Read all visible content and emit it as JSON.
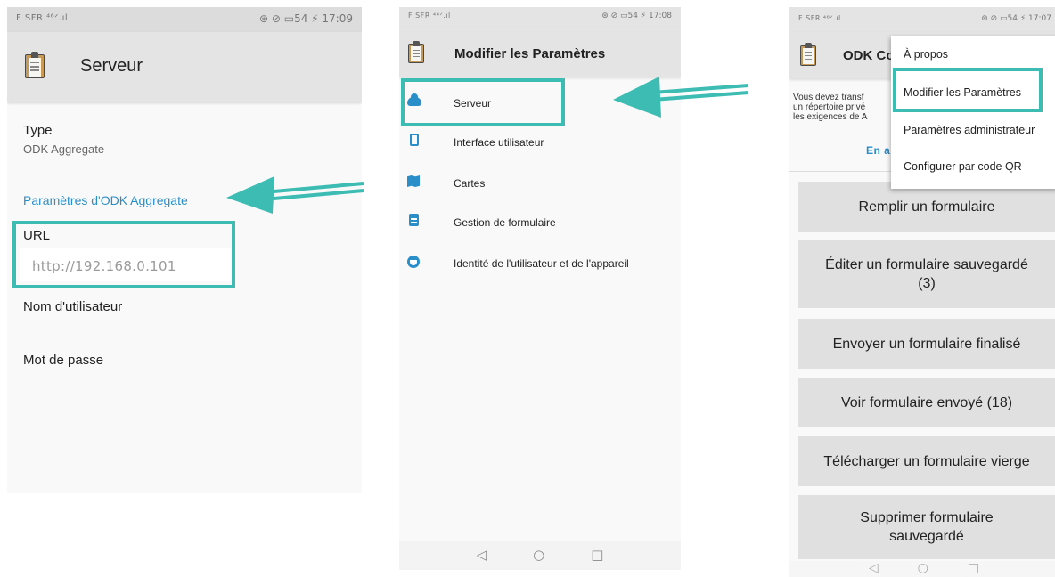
{
  "colors": {
    "accent": "#3cbcb3",
    "link": "#2a8ec9",
    "appbar": "#e4e4e4"
  },
  "screen1": {
    "status_left": "F SFR ⁴⁶ᐟ.ıl",
    "status_right": "⊛ ⊘ ▭54 ⚡ 17:09",
    "title": "Serveur",
    "type_label": "Type",
    "type_value": "ODK Aggregate",
    "category": "Paramètres d'ODK Aggregate",
    "url_label": "URL",
    "url_value": "http://192.168.0.101",
    "username_label": "Nom d'utilisateur",
    "password_label": "Mot de passe"
  },
  "screen2": {
    "status_left": "F SFR ⁴⁶ᐟ.ıl",
    "status_right": "⊛ ⊘ ▭54 ⚡ 17:08",
    "title": "Modifier les Paramètres",
    "items": [
      {
        "label": "Serveur",
        "icon": "cloud-icon"
      },
      {
        "label": "Interface utilisateur",
        "icon": "phone-icon"
      },
      {
        "label": "Cartes",
        "icon": "map-icon"
      },
      {
        "label": "Gestion de formulaire",
        "icon": "clipboard-icon"
      },
      {
        "label": "Identité de l'utilisateur et de l'appareil",
        "icon": "face-icon"
      }
    ],
    "nav": [
      "◁",
      "○",
      "□"
    ]
  },
  "screen3": {
    "status_left": "F SFR ⁴⁶ᐟ.ıl",
    "status_right": "⊛ ⊘ ▭54 ⚡ 17:07",
    "title": "ODK Co",
    "notice": "Vous devez transf\nun répertoire privé\nles exigences de A",
    "notice_link": "En ap",
    "overflow_menu": [
      "À propos",
      "Modifier les Paramètres",
      "Paramètres administrateur",
      "Configurer par code QR"
    ],
    "buttons": [
      "Remplir un formulaire",
      "Éditer un formulaire sauvegardé\n(3)",
      "Envoyer un formulaire finalisé",
      "Voir formulaire envoyé (18)",
      "Télécharger un formulaire vierge",
      "Supprimer formulaire\nsauvegardé"
    ],
    "nav": [
      "◁",
      "○",
      "□"
    ]
  }
}
